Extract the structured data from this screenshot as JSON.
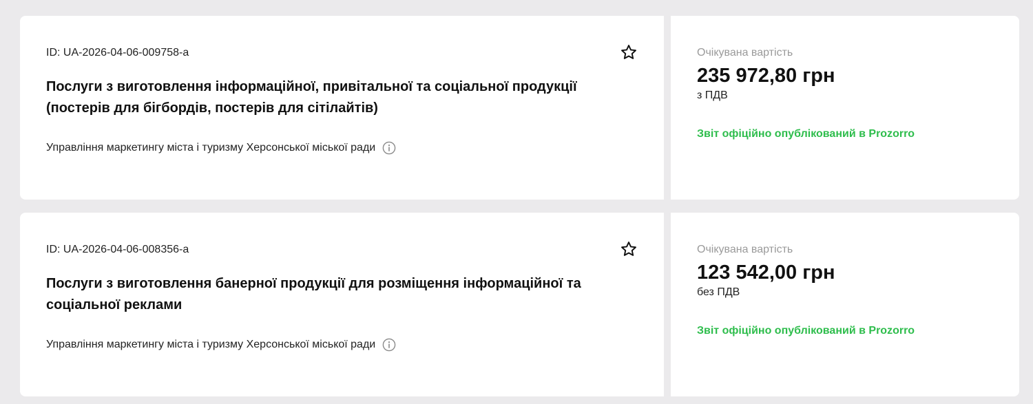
{
  "tenders": [
    {
      "id_text": "ID: UA-2026-04-06-009758-a",
      "title": "Послуги з виготовлення інформаційної, привітальної та соціальної продукції (постерів для бігбордів, постерів для сітілайтів)",
      "organization": "Управління маркетингу міста і туризму Херсонської міської ради",
      "expected_label": "Очікувана вартість",
      "amount": "235 972,80 грн",
      "vat": "з ПДВ",
      "report_status": "Звіт офіційно опублікований в Prozorro",
      "favorite_icon": "star-outline-icon",
      "info_icon": "info-icon"
    },
    {
      "id_text": "ID: UA-2026-04-06-008356-a",
      "title": "Послуги з виготовлення банерної продукції для розміщення інформаційної та соціальної реклами",
      "organization": "Управління маркетингу міста і туризму Херсонської міської ради",
      "expected_label": "Очікувана вартість",
      "amount": "123 542,00 грн",
      "vat": "без ПДВ",
      "report_status": "Звіт офіційно опублікований в Prozorro",
      "favorite_icon": "star-outline-icon",
      "info_icon": "info-icon"
    }
  ],
  "colors": {
    "page_background": "#ebeaec",
    "card_background": "#ffffff",
    "status_green": "#2ebd4c",
    "muted_label": "#9a9a9a"
  }
}
